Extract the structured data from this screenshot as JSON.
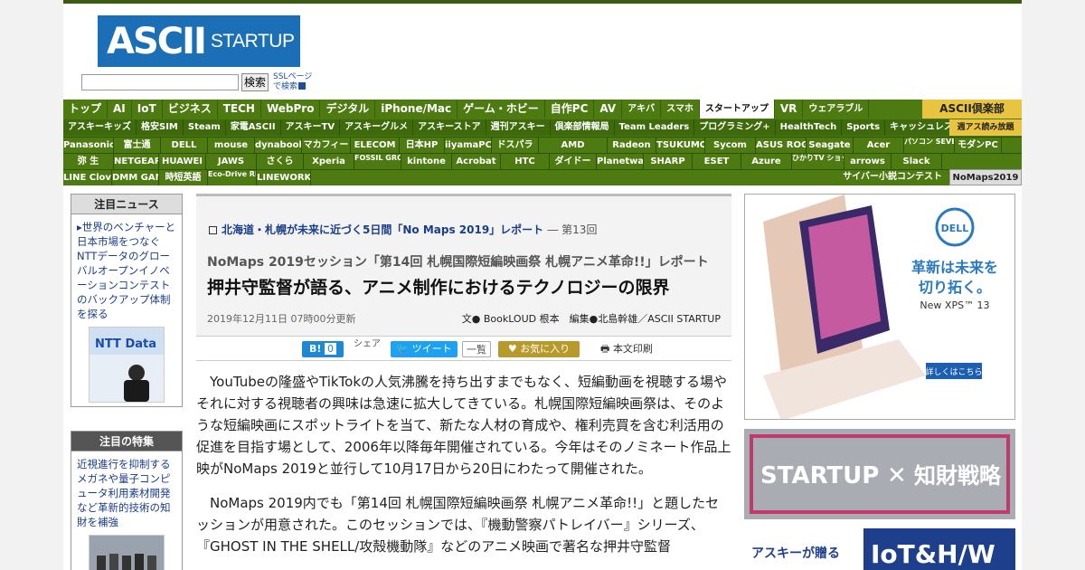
{
  "logo": {
    "brand": "ASCII",
    "sub": "STARTUP"
  },
  "search": {
    "placeholder": "",
    "button": "検索",
    "ssl_line1": "SSLページ",
    "ssl_line2": "で検索"
  },
  "nav_main": [
    "トップ",
    "AI",
    "IoT",
    "ビジネス",
    "TECH",
    "WebPro",
    "デジタル",
    "iPhone/Mac",
    "ゲーム・ホビー",
    "自作PC",
    "AV",
    "アキバ",
    "スマホ",
    "スタートアップ",
    "VR",
    "ウェアラブル"
  ],
  "nav_selected": "スタートアップ",
  "club": "ASCII倶楽部",
  "nav_sub": [
    "アスキーキッズ",
    "格安SIM",
    "Steam",
    "家電ASCII",
    "アスキーTV",
    "アスキーグルメ",
    "アスキーストア",
    "週刊アスキー",
    "倶楽部情報局",
    "Team Leaders",
    "プログラミング+",
    "HealthTech",
    "Sports",
    "キャッシュレス"
  ],
  "shukan_badge": "週アス読み放題",
  "brand_rows": [
    [
      "Panasonic",
      "富士通",
      "DELL",
      "mouse",
      "dynabook",
      "マカフィー",
      "ELECOM",
      "日本HP",
      "iiyamaPC",
      "ドスパラ",
      "AMD",
      "Radeon",
      "TSUKUMO",
      "Sycom",
      "ASUS ROG",
      "Seagate",
      "Acer",
      "パソコン SEVEN",
      "モダンPC"
    ],
    [
      "弥 生",
      "NETGEAR",
      "HUAWEI",
      "JAWS",
      "さくら",
      "Xperia",
      "FOSSIL GROUP",
      "kintone",
      "Acrobat",
      "HTC",
      "ダイドー",
      "Planetway",
      "SHARP",
      "ESET",
      "Azure",
      "ひかりTV ショッピング",
      "arrows",
      "Slack"
    ],
    [
      "LINE Clova",
      "DMM GAMES",
      "時短英語",
      "Eco-Drive Riiiver",
      "LINEWORKS"
    ]
  ],
  "cyber": "サイバー小説コンテスト",
  "nomaps_tab": "NoMaps2019",
  "sidebar": {
    "news_head": "注目ニュース",
    "news_text": "世界のベンチャーと日本市場をつなぐNTTデータのグローバルオープンイノベーションコンテストのバックアップ体制を探る",
    "news_photo_label": "NTT Data",
    "feature_head": "注目の特集",
    "feature_text": "近視進行を抑制するメガネや量子コンピュータ利用素材開発など革新的技術の知財を補強"
  },
  "article": {
    "series": "北海道・札幌が未来に近づく5日間「No Maps 2019」レポート",
    "series_no": "― 第13回",
    "subtitle": "NoMaps 2019セッション「第14回 札幌国際短編映画祭 札幌アニメ革命!!」レポート",
    "title": "押井守監督が語る、アニメ制作におけるテクノロジーの限界",
    "date": "2019年12月11日 07時00分更新",
    "byline": "文● BookLOUD 根本　編集●北島幹雄／ASCII STARTUP",
    "paragraphs": [
      "YouTubeの隆盛やTikTokの人気沸騰を持ち出すまでもなく、短編動画を視聴する場やそれに対する視聴者の興味は急速に拡大してきている。札幌国際短編映画祭は、そのような短編映画にスポットライトを当て、新たな人材の育成や、権利売買を含む利活用の促進を目指す場として、2006年以降毎年開催されている。今年はそのノミネート作品上映がNoMaps 2019と並行して10月17日から20日にわたって開催された。",
      "NoMaps 2019内でも「第14回 札幌国際短編映画祭 札幌アニメ革命!!」と題したセッションが用意された。このセッションでは、『機動警察パトレイバー』シリーズ、『GHOST IN THE SHELL/攻殻機動隊』などのアニメ映画で著名な押井守監督"
    ]
  },
  "share": {
    "hatena": "B!",
    "hatena_count": "0",
    "share_label": "シェア",
    "tweet": "ツイート",
    "list": "一覧",
    "fav": "お気に入り",
    "print": "本文印刷"
  },
  "ads": {
    "dell_logo": "DELL",
    "dell_copy1": "革新は未来を",
    "dell_copy2": "切り拓く。",
    "dell_model": "New XPS™ 13",
    "dell_btn": "詳しくはこちら",
    "startup_left": "STARTUP",
    "startup_right": "知財戦略",
    "ad3_left": "アスキーが贈る",
    "ad3_right": "IoT&H/W"
  }
}
